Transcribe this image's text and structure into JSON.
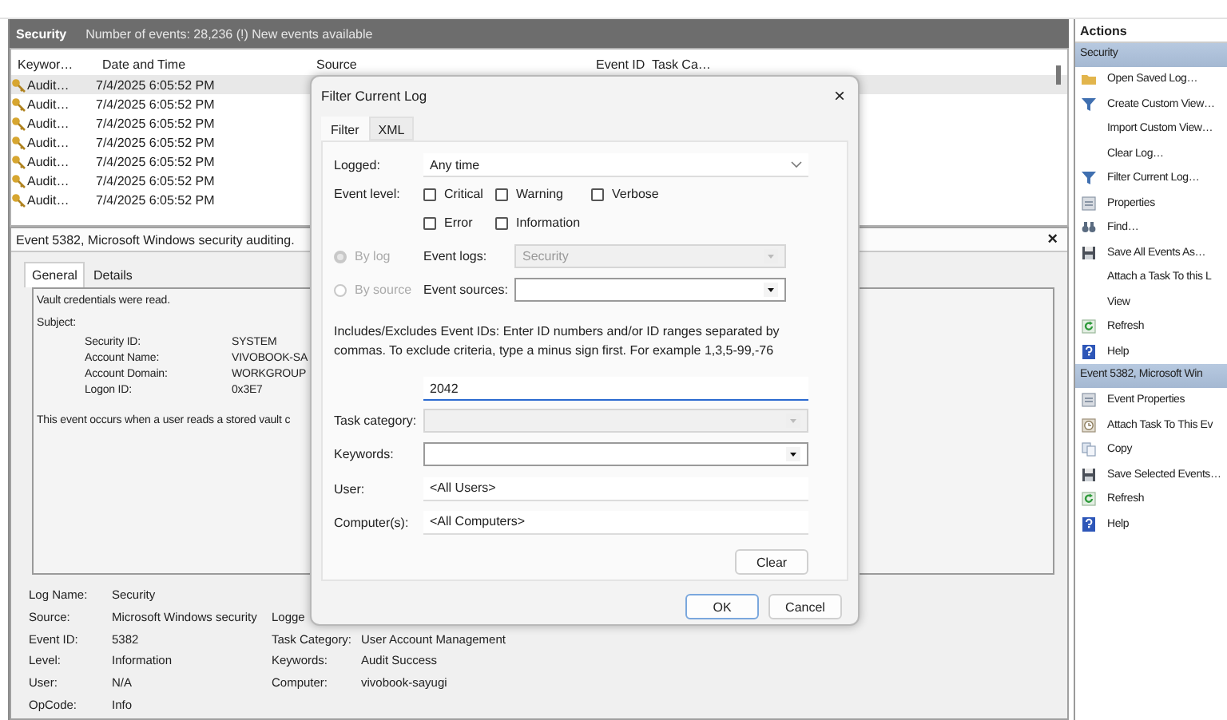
{
  "header": {
    "title": "Security",
    "info": "Number of events: 28,236 (!) New events available"
  },
  "event_list": {
    "columns": [
      "Keywor…",
      "Date and Time",
      "Source",
      "Event ID",
      "Task Ca…"
    ],
    "rows": [
      {
        "keyword": "Audit…",
        "date_time": "7/4/2025 6:05:52 PM",
        "selected": true
      },
      {
        "keyword": "Audit…",
        "date_time": "7/4/2025 6:05:52 PM",
        "selected": false
      },
      {
        "keyword": "Audit…",
        "date_time": "7/4/2025 6:05:52 PM",
        "selected": false
      },
      {
        "keyword": "Audit…",
        "date_time": "7/4/2025 6:05:52 PM",
        "selected": false
      },
      {
        "keyword": "Audit…",
        "date_time": "7/4/2025 6:05:52 PM",
        "selected": false
      },
      {
        "keyword": "Audit…",
        "date_time": "7/4/2025 6:05:52 PM",
        "selected": false
      },
      {
        "keyword": "Audit…",
        "date_time": "7/4/2025 6:05:52 PM",
        "selected": false
      }
    ]
  },
  "event_detail": {
    "title": "Event 5382, Microsoft Windows security auditing.",
    "close": "×",
    "tabs": [
      {
        "label": "General",
        "selected": true
      },
      {
        "label": "Details",
        "selected": false
      }
    ],
    "message": {
      "summary": "Vault credentials were read.",
      "subject_label": "Subject:",
      "subject": [
        {
          "label": "Security ID:",
          "value": "SYSTEM"
        },
        {
          "label": "Account Name:",
          "value": "VIVOBOOK-SA"
        },
        {
          "label": "Account Domain:",
          "value": "WORKGROUP"
        },
        {
          "label": "Logon ID:",
          "value": "0x3E7"
        }
      ],
      "note": "This event occurs when a user reads a stored vault c"
    },
    "fields": [
      {
        "label": "Log Name:",
        "value": "Security"
      },
      {
        "label": "Source:",
        "value": "Microsoft Windows security",
        "label_2": "Logge"
      },
      {
        "label": "Event ID:",
        "value": "5382",
        "label_2": "Task Category:",
        "value_2": "User Account Management"
      },
      {
        "label": "Level:",
        "value": "Information",
        "label_2": "Keywords:",
        "value_2": "Audit Success"
      },
      {
        "label": "User:",
        "value": "N/A",
        "label_2": "Computer:",
        "value_2": "vivobook-sayugi"
      },
      {
        "label": "OpCode:",
        "value": "Info"
      }
    ]
  },
  "dialog": {
    "title": "Filter Current Log",
    "close": "×",
    "tabs": [
      {
        "label": "Filter",
        "selected": true
      },
      {
        "label": "XML",
        "selected": false
      }
    ],
    "logged": {
      "label": "Logged:",
      "value": "Any time"
    },
    "event_level": {
      "label": "Event level:",
      "options": [
        {
          "label": "Critical",
          "checked": false
        },
        {
          "label": "Warning",
          "checked": false
        },
        {
          "label": "Verbose",
          "checked": false
        },
        {
          "label": "Error",
          "checked": false
        },
        {
          "label": "Information",
          "checked": false
        }
      ]
    },
    "sources": [
      {
        "label": "By log",
        "selected": true,
        "disabled": true,
        "field_label": "Event logs:",
        "value": "Security",
        "field_disabled": true
      },
      {
        "label": "By source",
        "selected": false,
        "disabled": true,
        "field_label": "Event sources:",
        "field_disabled": false
      }
    ],
    "ids": {
      "description": "Includes/Excludes Event IDs: Enter ID numbers and/or ID ranges separated by commas. To exclude criteria, type a minus sign first. For example 1,3,5-99,-76",
      "value": "2042"
    },
    "task_category": {
      "label": "Task category:",
      "disabled": true
    },
    "keywords": {
      "label": "Keywords:",
      "disabled": false
    },
    "user": {
      "label": "User:",
      "value": "<All Users>"
    },
    "computers": {
      "label": "Computer(s):",
      "value": "<All Computers>"
    },
    "clear": "Clear",
    "ok": "OK",
    "cancel": "Cancel"
  },
  "actions": {
    "title": "Actions",
    "sections": [
      {
        "title": "Security",
        "items": [
          {
            "label": "Open Saved Log…",
            "kind": "open"
          },
          {
            "label": "Create Custom View…",
            "kind": "filter"
          },
          {
            "label": "Import Custom View…",
            "kind": "plain"
          },
          {
            "label": "Clear Log…",
            "kind": "plain"
          },
          {
            "label": "Filter Current Log…",
            "kind": "filter"
          },
          {
            "label": "Properties",
            "kind": "properties"
          },
          {
            "label": "Find…",
            "kind": "find"
          },
          {
            "label": "Save All Events As…",
            "kind": "save"
          },
          {
            "label": "Attach a Task To this L",
            "kind": "plain"
          },
          {
            "label": "View",
            "kind": "plain"
          },
          {
            "label": "Refresh",
            "kind": "refresh"
          },
          {
            "label": "Help",
            "kind": "help"
          }
        ]
      },
      {
        "title": "Event 5382, Microsoft Win",
        "items": [
          {
            "label": "Event Properties",
            "kind": "properties"
          },
          {
            "label": "Attach Task To This Ev",
            "kind": "task"
          },
          {
            "label": "Copy",
            "kind": "copy"
          },
          {
            "label": "Save Selected Events…",
            "kind": "save"
          },
          {
            "label": "Refresh",
            "kind": "refresh"
          },
          {
            "label": "Help",
            "kind": "help"
          }
        ]
      }
    ]
  }
}
